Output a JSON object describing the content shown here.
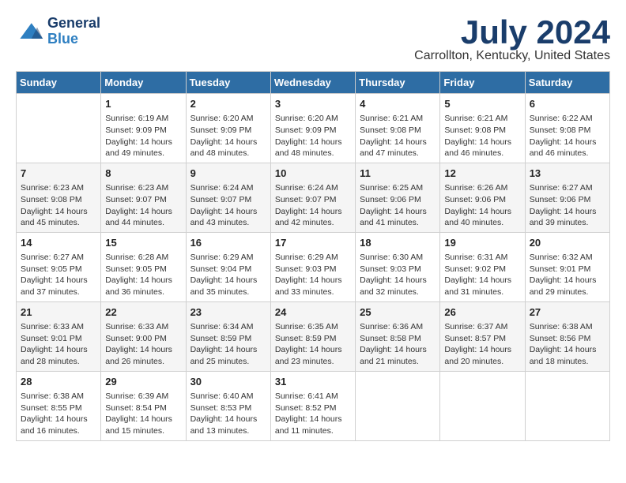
{
  "logo": {
    "line1": "General",
    "line2": "Blue"
  },
  "title": "July 2024",
  "subtitle": "Carrollton, Kentucky, United States",
  "days_header": [
    "Sunday",
    "Monday",
    "Tuesday",
    "Wednesday",
    "Thursday",
    "Friday",
    "Saturday"
  ],
  "weeks": [
    [
      {
        "day": "",
        "info": ""
      },
      {
        "day": "1",
        "info": "Sunrise: 6:19 AM\nSunset: 9:09 PM\nDaylight: 14 hours\nand 49 minutes."
      },
      {
        "day": "2",
        "info": "Sunrise: 6:20 AM\nSunset: 9:09 PM\nDaylight: 14 hours\nand 48 minutes."
      },
      {
        "day": "3",
        "info": "Sunrise: 6:20 AM\nSunset: 9:09 PM\nDaylight: 14 hours\nand 48 minutes."
      },
      {
        "day": "4",
        "info": "Sunrise: 6:21 AM\nSunset: 9:08 PM\nDaylight: 14 hours\nand 47 minutes."
      },
      {
        "day": "5",
        "info": "Sunrise: 6:21 AM\nSunset: 9:08 PM\nDaylight: 14 hours\nand 46 minutes."
      },
      {
        "day": "6",
        "info": "Sunrise: 6:22 AM\nSunset: 9:08 PM\nDaylight: 14 hours\nand 46 minutes."
      }
    ],
    [
      {
        "day": "7",
        "info": "Sunrise: 6:23 AM\nSunset: 9:08 PM\nDaylight: 14 hours\nand 45 minutes."
      },
      {
        "day": "8",
        "info": "Sunrise: 6:23 AM\nSunset: 9:07 PM\nDaylight: 14 hours\nand 44 minutes."
      },
      {
        "day": "9",
        "info": "Sunrise: 6:24 AM\nSunset: 9:07 PM\nDaylight: 14 hours\nand 43 minutes."
      },
      {
        "day": "10",
        "info": "Sunrise: 6:24 AM\nSunset: 9:07 PM\nDaylight: 14 hours\nand 42 minutes."
      },
      {
        "day": "11",
        "info": "Sunrise: 6:25 AM\nSunset: 9:06 PM\nDaylight: 14 hours\nand 41 minutes."
      },
      {
        "day": "12",
        "info": "Sunrise: 6:26 AM\nSunset: 9:06 PM\nDaylight: 14 hours\nand 40 minutes."
      },
      {
        "day": "13",
        "info": "Sunrise: 6:27 AM\nSunset: 9:06 PM\nDaylight: 14 hours\nand 39 minutes."
      }
    ],
    [
      {
        "day": "14",
        "info": "Sunrise: 6:27 AM\nSunset: 9:05 PM\nDaylight: 14 hours\nand 37 minutes."
      },
      {
        "day": "15",
        "info": "Sunrise: 6:28 AM\nSunset: 9:05 PM\nDaylight: 14 hours\nand 36 minutes."
      },
      {
        "day": "16",
        "info": "Sunrise: 6:29 AM\nSunset: 9:04 PM\nDaylight: 14 hours\nand 35 minutes."
      },
      {
        "day": "17",
        "info": "Sunrise: 6:29 AM\nSunset: 9:03 PM\nDaylight: 14 hours\nand 33 minutes."
      },
      {
        "day": "18",
        "info": "Sunrise: 6:30 AM\nSunset: 9:03 PM\nDaylight: 14 hours\nand 32 minutes."
      },
      {
        "day": "19",
        "info": "Sunrise: 6:31 AM\nSunset: 9:02 PM\nDaylight: 14 hours\nand 31 minutes."
      },
      {
        "day": "20",
        "info": "Sunrise: 6:32 AM\nSunset: 9:01 PM\nDaylight: 14 hours\nand 29 minutes."
      }
    ],
    [
      {
        "day": "21",
        "info": "Sunrise: 6:33 AM\nSunset: 9:01 PM\nDaylight: 14 hours\nand 28 minutes."
      },
      {
        "day": "22",
        "info": "Sunrise: 6:33 AM\nSunset: 9:00 PM\nDaylight: 14 hours\nand 26 minutes."
      },
      {
        "day": "23",
        "info": "Sunrise: 6:34 AM\nSunset: 8:59 PM\nDaylight: 14 hours\nand 25 minutes."
      },
      {
        "day": "24",
        "info": "Sunrise: 6:35 AM\nSunset: 8:59 PM\nDaylight: 14 hours\nand 23 minutes."
      },
      {
        "day": "25",
        "info": "Sunrise: 6:36 AM\nSunset: 8:58 PM\nDaylight: 14 hours\nand 21 minutes."
      },
      {
        "day": "26",
        "info": "Sunrise: 6:37 AM\nSunset: 8:57 PM\nDaylight: 14 hours\nand 20 minutes."
      },
      {
        "day": "27",
        "info": "Sunrise: 6:38 AM\nSunset: 8:56 PM\nDaylight: 14 hours\nand 18 minutes."
      }
    ],
    [
      {
        "day": "28",
        "info": "Sunrise: 6:38 AM\nSunset: 8:55 PM\nDaylight: 14 hours\nand 16 minutes."
      },
      {
        "day": "29",
        "info": "Sunrise: 6:39 AM\nSunset: 8:54 PM\nDaylight: 14 hours\nand 15 minutes."
      },
      {
        "day": "30",
        "info": "Sunrise: 6:40 AM\nSunset: 8:53 PM\nDaylight: 14 hours\nand 13 minutes."
      },
      {
        "day": "31",
        "info": "Sunrise: 6:41 AM\nSunset: 8:52 PM\nDaylight: 14 hours\nand 11 minutes."
      },
      {
        "day": "",
        "info": ""
      },
      {
        "day": "",
        "info": ""
      },
      {
        "day": "",
        "info": ""
      }
    ]
  ]
}
